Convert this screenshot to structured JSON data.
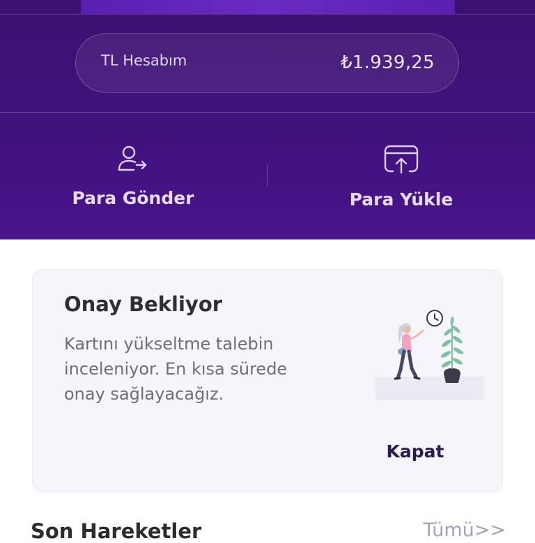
{
  "account": {
    "label": "TL Hesabım",
    "balance": "₺1.939,25"
  },
  "actions": [
    {
      "label": "Para Gönder",
      "icon": "user-send-icon"
    },
    {
      "label": "Para Yükle",
      "icon": "upload-card-icon"
    }
  ],
  "notice": {
    "title": "Onay Bekliyor",
    "body": "Kartını yükseltme talebin inceleniyor. En kısa sürede onay sağlayacağız.",
    "close_label": "Kapat",
    "illustration": "woman-walking-clock-plant-illustration"
  },
  "recent": {
    "title": "Son Hareketler",
    "see_all": "Tümü>>"
  },
  "colors": {
    "header_bg": "#40127c",
    "card_bg": "#f6f5fa",
    "accent_text": "#2a1a4e"
  }
}
